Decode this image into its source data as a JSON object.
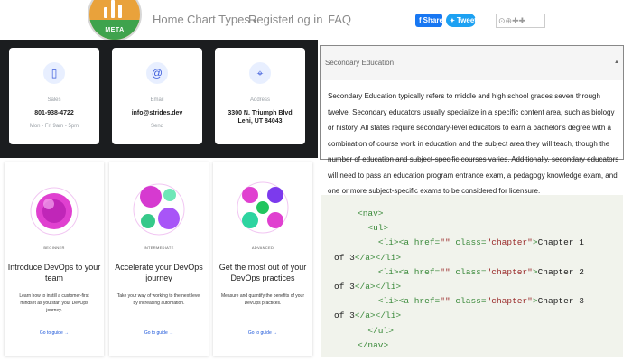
{
  "topnav": {
    "logo_text": "META",
    "items": [
      "Home",
      "Chart Types",
      "Register",
      "Log in",
      "FAQ"
    ],
    "chart_types_caret": "▾",
    "share_label": "Share",
    "tweet_label": "Tweet",
    "search_glyphs": "⊙⊕✚✚"
  },
  "contact": {
    "cards": [
      {
        "icon": "phone-icon",
        "label": "Sales",
        "value": "801-938-4722",
        "sub": "Mon - Fri 9am - 5pm"
      },
      {
        "icon": "at-icon",
        "label": "Email",
        "value": "info@strides.dev",
        "sub": "Send"
      },
      {
        "icon": "location-icon",
        "label": "Address",
        "value": "3300 N. Triumph Blvd\nLehi, UT 84043",
        "sub": ""
      }
    ]
  },
  "guides": [
    {
      "tier": "BEGINNER",
      "title": "Introduce DevOps to your team",
      "desc": "Learn how to instill a customer-first mindset as you start your DevOps journey.",
      "link": "Go to guide →"
    },
    {
      "tier": "INTERMEDIATE",
      "title": "Accelerate your DevOps journey",
      "desc": "Take your way of working to the next level by increasing automation.",
      "link": "Go to guide →"
    },
    {
      "tier": "ADVANCED",
      "title": "Get the most out of your DevOps practices",
      "desc": "Measure and quantify the benefits of your DevOps practices.",
      "link": "Go to guide →"
    }
  ],
  "accordion": {
    "title": "Secondary Education",
    "toggle": "▲",
    "body": "Secondary Education typically refers to middle and high school grades seven through twelve. Secondary educators usually specialize in a specific content area, such as biology or history. All states require secondary-level educators to earn a bachelor's degree with a combination of course work in education and the subject area they will teach, though the number of education and subject-specific courses varies. Additionally, secondary educators will need to pass an education program entrance exam, a pedagogy knowledge exam, and one or more subject-specific exams to be considered for licensure."
  },
  "code": {
    "lines": [
      {
        "indent": "",
        "parts": [
          [
            "tag",
            "<nav>"
          ]
        ]
      },
      {
        "indent": "  ",
        "parts": [
          [
            "tag",
            "<ul>"
          ]
        ]
      },
      {
        "indent": "    ",
        "parts": [
          [
            "tag",
            "<li>"
          ],
          [
            "tag",
            "<a "
          ],
          [
            "attr",
            "href="
          ],
          [
            "str",
            "\"\""
          ],
          [
            "attr",
            " class="
          ],
          [
            "str",
            "\"chapter\""
          ],
          [
            "tag",
            ">"
          ],
          [
            "txt",
            "Chapter 1"
          ]
        ]
      },
      {
        "indent": "",
        "parts": [
          [
            "txt",
            "of 3"
          ],
          [
            "tag",
            "</a></li>"
          ]
        ]
      },
      {
        "indent": "    ",
        "parts": [
          [
            "tag",
            "<li>"
          ],
          [
            "tag",
            "<a "
          ],
          [
            "attr",
            "href="
          ],
          [
            "str",
            "\"\""
          ],
          [
            "attr",
            " class="
          ],
          [
            "str",
            "\"chapter\""
          ],
          [
            "tag",
            ">"
          ],
          [
            "txt",
            "Chapter 2"
          ]
        ]
      },
      {
        "indent": "",
        "parts": [
          [
            "txt",
            "of 3"
          ],
          [
            "tag",
            "</a></li>"
          ]
        ]
      },
      {
        "indent": "    ",
        "parts": [
          [
            "tag",
            "<li>"
          ],
          [
            "tag",
            "<a "
          ],
          [
            "attr",
            "href="
          ],
          [
            "str",
            "\"\""
          ],
          [
            "attr",
            " class="
          ],
          [
            "str",
            "\"chapter\""
          ],
          [
            "tag",
            ">"
          ],
          [
            "txt",
            "Chapter 3"
          ]
        ]
      },
      {
        "indent": "",
        "parts": [
          [
            "txt",
            "of 3"
          ],
          [
            "tag",
            "</a></li>"
          ]
        ]
      },
      {
        "indent": "  ",
        "parts": [
          [
            "tag",
            "</ul>"
          ]
        ]
      },
      {
        "indent": "",
        "parts": [
          [
            "tag",
            "</nav>"
          ]
        ]
      }
    ]
  },
  "colors": {
    "share": "#1877f2",
    "tweet": "#1da1f2",
    "dark": "#1b1d1f",
    "link": "#1a55d9"
  }
}
